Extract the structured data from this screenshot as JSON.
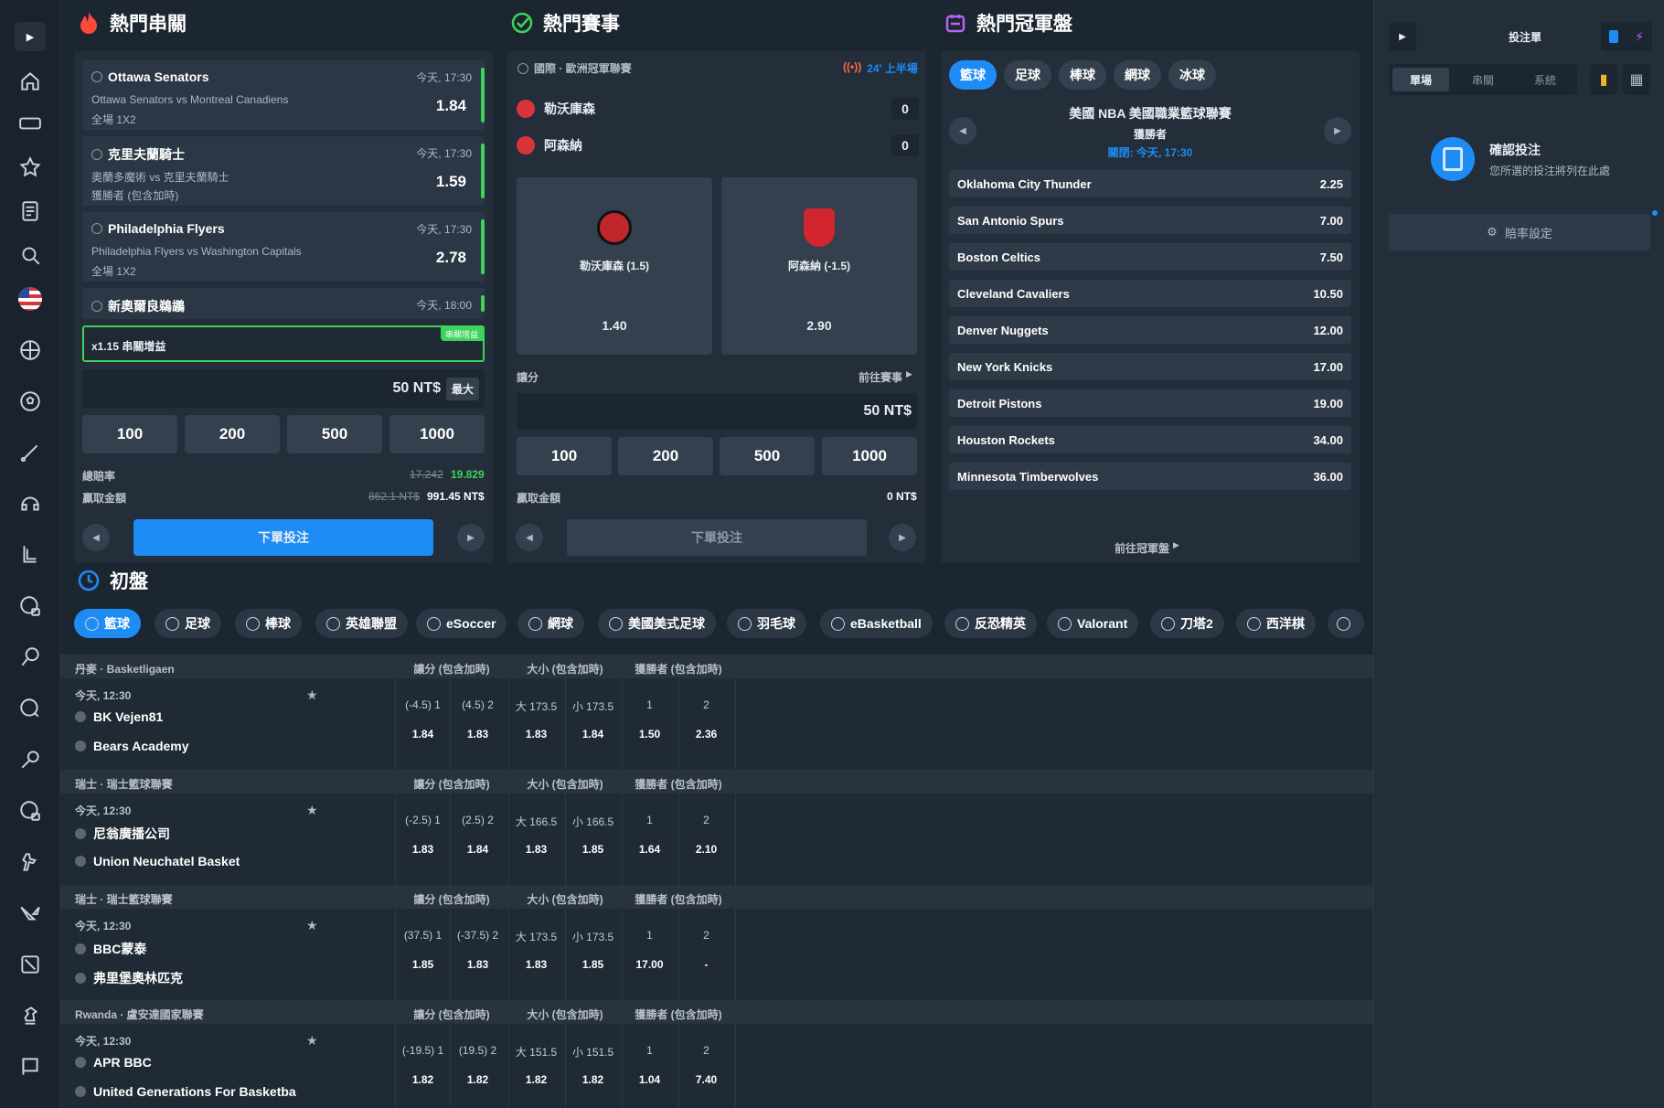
{
  "sections": {
    "parlay": "熱門串關",
    "matches": "熱門賽事",
    "champion": "熱門冠軍盤",
    "early": "初盤"
  },
  "parlay": {
    "cards": [
      {
        "name": "Ottawa Senators",
        "time": "今天, 17:30",
        "sub": "Ottawa Senators vs Montreal Canadiens",
        "market": "全場 1X2",
        "odd": "1.84"
      },
      {
        "name": "克里夫蘭騎士",
        "time": "今天, 17:30",
        "sub": "奧蘭多魔術 vs 克里夫蘭騎士",
        "market": "獲勝者 (包含加時)",
        "odd": "1.59"
      },
      {
        "name": "Philadelphia Flyers",
        "time": "今天, 17:30",
        "sub": "Philadelphia Flyers vs Washington Capitals",
        "market": "全場 1X2",
        "odd": "2.78"
      },
      {
        "name": "新奧爾良鵜鶘",
        "time": "今天, 18:00",
        "sub": "",
        "market": "",
        "odd": ""
      }
    ],
    "boost_label": "x1.15 串關增益",
    "boost_badge": "串關增益",
    "stake": "50 NT$",
    "max": "最大",
    "chips": [
      "100",
      "200",
      "500",
      "1000"
    ],
    "total_odds_label": "總賠率",
    "total_odds_old": "17.242",
    "total_odds_new": "19.829",
    "win_label": "贏取金額",
    "win_old": "862.1 NT$",
    "win_new": "991.45 NT$",
    "submit": "下單投注"
  },
  "match": {
    "league": "國際 · 歐洲冠軍聯賽",
    "live": "24' 上半場",
    "home": "勒沃庫森",
    "away": "阿森納",
    "home_score": "0",
    "away_score": "0",
    "opt1_label": "勒沃庫森 (1.5)",
    "opt1_odd": "1.40",
    "opt2_label": "阿森納 (-1.5)",
    "opt2_odd": "2.90",
    "market": "讓分",
    "goto": "前往賽事",
    "stake": "50 NT$",
    "chips": [
      "100",
      "200",
      "500",
      "1000"
    ],
    "win_label": "贏取金額",
    "win_value": "0 NT$",
    "submit": "下單投注"
  },
  "champion": {
    "tabs": [
      "籃球",
      "足球",
      "棒球",
      "網球",
      "冰球"
    ],
    "title": "美國 NBA 美國職業籃球聯賽",
    "market": "獲勝者",
    "close": "關閉: 今天, 17:30",
    "rows": [
      {
        "n": "Oklahoma City Thunder",
        "o": "2.25"
      },
      {
        "n": "San Antonio Spurs",
        "o": "7.00"
      },
      {
        "n": "Boston Celtics",
        "o": "7.50"
      },
      {
        "n": "Cleveland Cavaliers",
        "o": "10.50"
      },
      {
        "n": "Denver Nuggets",
        "o": "12.00"
      },
      {
        "n": "New York Knicks",
        "o": "17.00"
      },
      {
        "n": "Detroit Pistons",
        "o": "19.00"
      },
      {
        "n": "Houston Rockets",
        "o": "34.00"
      },
      {
        "n": "Minnesota Timberwolves",
        "o": "36.00"
      }
    ],
    "goto": "前往冠軍盤"
  },
  "sport_tabs": [
    "籃球",
    "足球",
    "棒球",
    "英雄聯盟",
    "eSoccer",
    "網球",
    "美國美式足球",
    "羽毛球",
    "eBasketball",
    "反恐精英",
    "Valorant",
    "刀塔2",
    "西洋棋"
  ],
  "col_heads": [
    "讓分 (包含加時)",
    "大小 (包含加時)",
    "獲勝者 (包含加時)"
  ],
  "events": [
    {
      "league": "丹麥 · Basketligaen",
      "time": "今天, 12:30",
      "home": "BK Vejen81",
      "away": "Bears Academy",
      "cells": [
        [
          "(-4.5) 1",
          "1.84"
        ],
        [
          "(4.5) 2",
          "1.83"
        ],
        [
          "大 173.5",
          "1.83"
        ],
        [
          "小 173.5",
          "1.84"
        ],
        [
          "1",
          "1.50"
        ],
        [
          "2",
          "2.36"
        ]
      ]
    },
    {
      "league": "瑞士 · 瑞士籃球聯賽",
      "time": "今天, 12:30",
      "home": "尼翁廣播公司",
      "away": "Union Neuchatel Basket",
      "cells": [
        [
          "(-2.5) 1",
          "1.83"
        ],
        [
          "(2.5) 2",
          "1.84"
        ],
        [
          "大 166.5",
          "1.83"
        ],
        [
          "小 166.5",
          "1.85"
        ],
        [
          "1",
          "1.64"
        ],
        [
          "2",
          "2.10"
        ]
      ]
    },
    {
      "league": "瑞士 · 瑞士籃球聯賽",
      "time": "今天, 12:30",
      "home": "BBC蒙泰",
      "away": "弗里堡奧林匹克",
      "cells": [
        [
          "(37.5) 1",
          "1.85"
        ],
        [
          "(-37.5) 2",
          "1.83"
        ],
        [
          "大 173.5",
          "1.83"
        ],
        [
          "小 173.5",
          "1.85"
        ],
        [
          "1",
          "17.00"
        ],
        [
          "2",
          "-"
        ]
      ]
    },
    {
      "league": "Rwanda · 盧安達國家聯賽",
      "time": "今天, 12:30",
      "home": "APR BBC",
      "away": "United Generations For Basketba",
      "cells": [
        [
          "(-19.5) 1",
          "1.82"
        ],
        [
          "(19.5) 2",
          "1.82"
        ],
        [
          "大 151.5",
          "1.82"
        ],
        [
          "小 151.5",
          "1.82"
        ],
        [
          "1",
          "1.04"
        ],
        [
          "2",
          "7.40"
        ]
      ]
    }
  ],
  "slip": {
    "title": "投注單",
    "tabs": [
      "單場",
      "串關",
      "系統"
    ],
    "confirm": "確認投注",
    "hint": "您所選的投注將列在此處",
    "settings": "賠率設定"
  },
  "colors": {
    "accent": "#1e8cf5",
    "green": "#3cd45a",
    "live": "#ff6a3d",
    "panel": "#232e3a",
    "bg": "#1c2631"
  }
}
